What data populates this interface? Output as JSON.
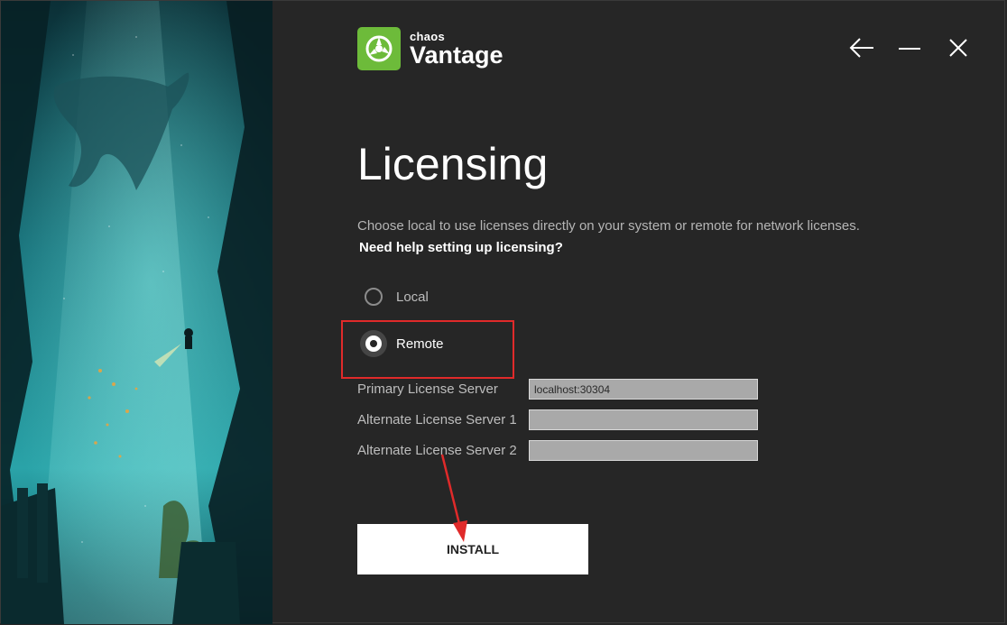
{
  "logo": {
    "brand": "chaos",
    "product": "Vantage"
  },
  "window_controls": {
    "back_icon": "arrow-left-icon",
    "minimize_icon": "minimize-icon",
    "close_icon": "close-icon"
  },
  "page": {
    "title": "Licensing",
    "description": "Choose local to use licenses directly on your system or remote for network licenses.",
    "help_link": "Need help setting up licensing?"
  },
  "license_mode": {
    "options": [
      {
        "label": "Local",
        "selected": false
      },
      {
        "label": "Remote",
        "selected": true
      }
    ]
  },
  "servers": {
    "primary_label": "Primary License Server",
    "primary_value": "localhost:30304",
    "alt1_label": "Alternate License Server 1",
    "alt1_value": "",
    "alt2_label": "Alternate License Server 2",
    "alt2_value": ""
  },
  "install_label": "INSTALL",
  "colors": {
    "background": "#262626",
    "brand_green": "#6dbb3a",
    "annotation_red": "#e02a2a",
    "field_bg": "#a9a9a9"
  }
}
